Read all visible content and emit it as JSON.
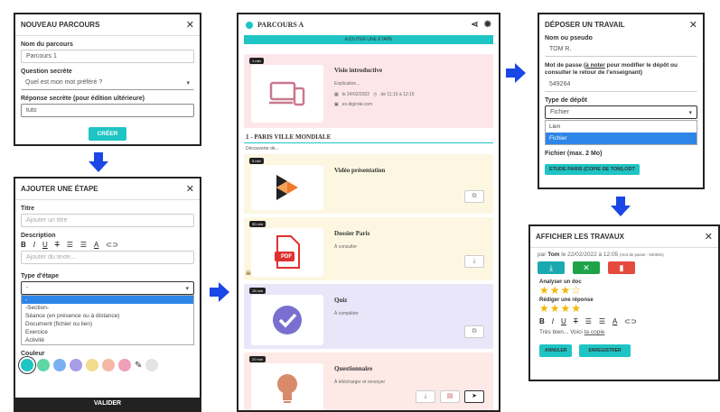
{
  "colors": {
    "accent": "#1fc4c4",
    "arrow": "#1a47e5",
    "step1": "#fde6ea",
    "step2": "#fdf7e1",
    "step3": "#e8e6f8",
    "step4": "#fde9e6"
  },
  "p1": {
    "title": "NOUVEAU PARCOURS",
    "name_label": "Nom du parcours",
    "name_value": "Parcours 1",
    "q_label": "Question secrète",
    "q_value": "Quel est mon mot préféré ?",
    "a_label": "Réponse secrète (pour édition ultérieure)",
    "a_value": "tuto",
    "create": "CRÉER"
  },
  "p2": {
    "title": "AJOUTER UNE ÉTAPE",
    "t_label": "Titre",
    "t_ph": "Ajouter un titre",
    "d_label": "Description",
    "d_ph": "Ajouter du texte...",
    "type_label": "Type d'étape",
    "type_value": "-",
    "options": [
      "-",
      "-Section-",
      "Séance (en présence ou à distance)",
      "Document (fichier ou lien)",
      "Exercice",
      "Activité"
    ],
    "color_label": "Couleur",
    "validate": "VALIDER"
  },
  "p3": {
    "title": "PARCOURS A",
    "add": "AJOUTER UNE ÉTAPE",
    "s1": {
      "tag": "1 min",
      "title": "Visio introductive",
      "desc": "Explication...",
      "date": "le 24/02/2022",
      "time": "de 11:15 à 12:15",
      "link": "ex.digirole.com"
    },
    "section": "1 - PARIS VILLE MONDIALE",
    "section_desc": "Découverte de...",
    "s2": {
      "tag": "5 min",
      "title": "Vidéo présentation"
    },
    "s3": {
      "tag": "30 min",
      "title": "Dossier Paris",
      "desc": "À consulter",
      "pdf": "PDF"
    },
    "s4": {
      "tag": "15 min",
      "title": "Quiz",
      "desc": "À compléter"
    },
    "s5": {
      "tag": "20 min",
      "title": "Questionnaire",
      "desc": "À télécharger et renvoyer"
    }
  },
  "p4": {
    "title": "DÉPOSER UN TRAVAIL",
    "n_label": "Nom ou pseudo",
    "n_value": "TOM R.",
    "pw_label_a": "Mot de passe (",
    "pw_label_u": "à noter",
    "pw_label_b": " pour modifier le dépôt ou consulter le retour de l'enseignant)",
    "pw_value": "549264",
    "type_label": "Type de dépôt",
    "type_value": "Fichier",
    "opt1": "Lien",
    "opt2": "Fichier",
    "file_label": "Fichier (max. 2 Mo)",
    "file_value": "ETUDE PARIS (COPIE DE TOM).ODT"
  },
  "p5": {
    "title": "AFFICHER LES TRAVAUX",
    "by": "par",
    "user": "Tom",
    "date": "le 22/02/2022 à 12:05",
    "pw": "(mot de passe : 920091)",
    "c1": "Analyser un doc",
    "s1": "★★★☆",
    "c2": "Rédiger une réponse",
    "s2": "★★★★",
    "comment_a": "Très bien... Voici ",
    "comment_link": "ta copie",
    "cancel": "ANNULER",
    "save": "ENREGISTRER"
  }
}
